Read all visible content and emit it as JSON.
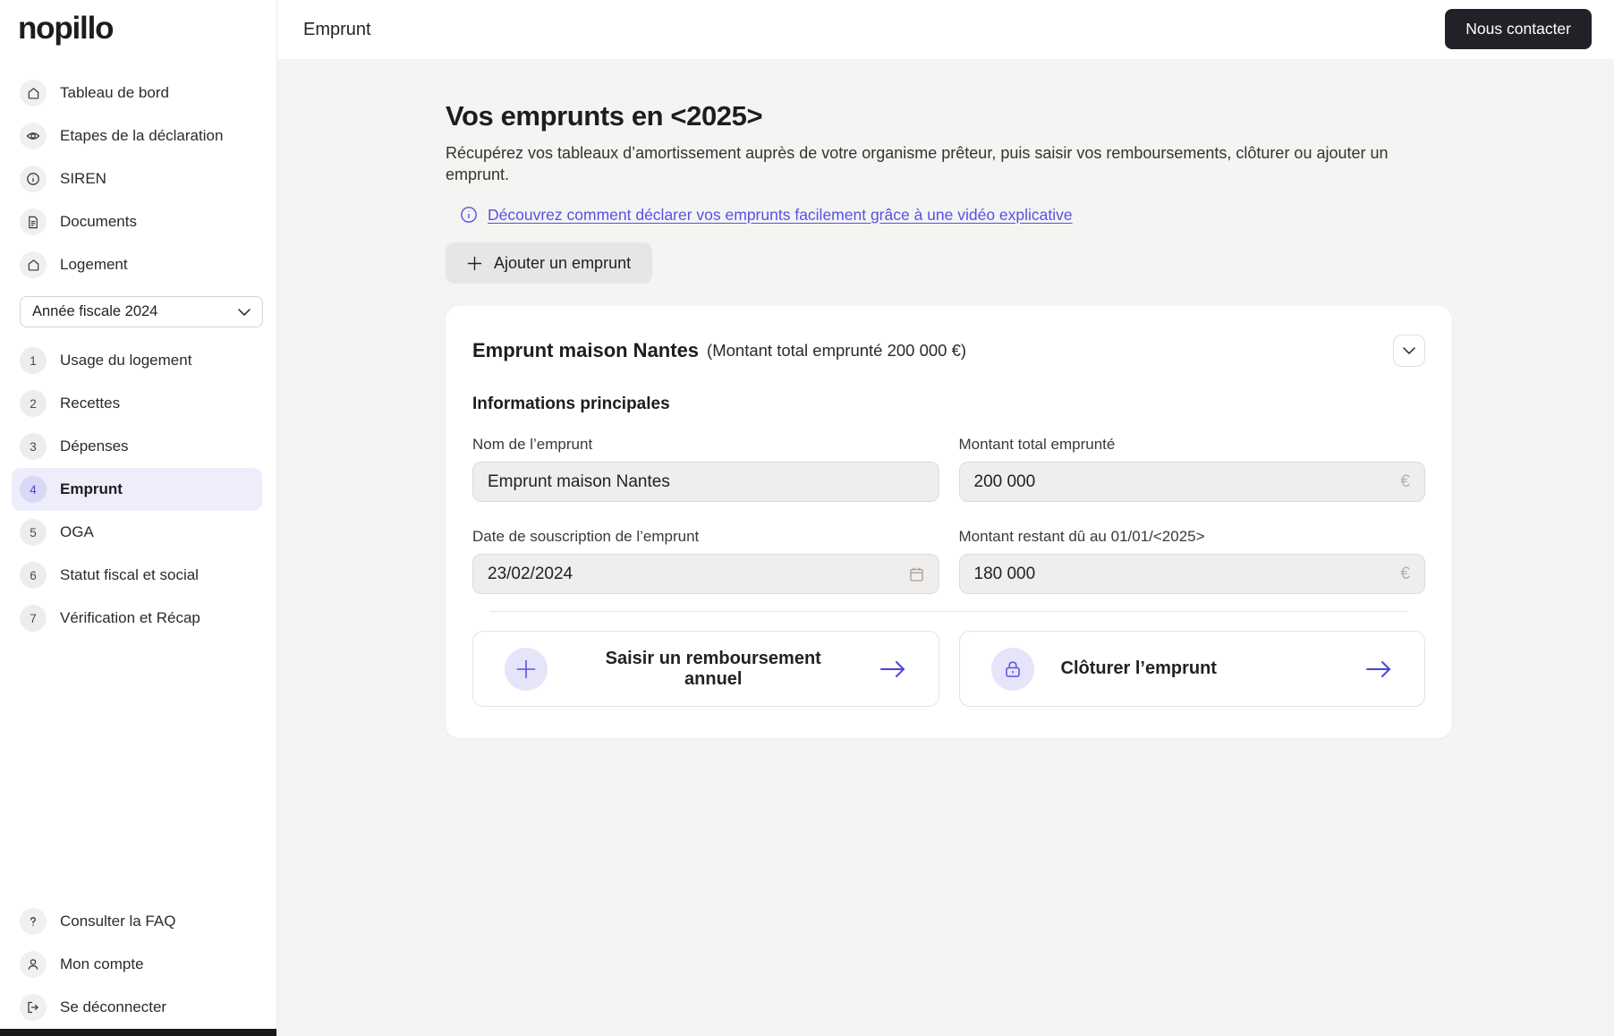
{
  "brand": "nopillo",
  "colors": {
    "accent_indigo": "#5652e2",
    "accent_lavender_bg": "#e6e4f9",
    "active_step_bg": "#eeedfb",
    "dark_button": "#232127",
    "page_bg": "#f4f4f3",
    "input_bg": "#efeeec"
  },
  "topbar": {
    "title": "Emprunt",
    "contact_button": "Nous contacter"
  },
  "sidebar": {
    "nav": [
      {
        "icon": "home-icon",
        "label": "Tableau de bord"
      },
      {
        "icon": "eye-icon",
        "label": "Etapes de la déclaration"
      },
      {
        "icon": "info-icon",
        "label": "SIREN"
      },
      {
        "icon": "document-icon",
        "label": "Documents"
      },
      {
        "icon": "home-icon",
        "label": "Logement"
      }
    ],
    "year_select": "Année fiscale 2024",
    "steps": [
      {
        "num": "1",
        "label": "Usage du logement",
        "active": false
      },
      {
        "num": "2",
        "label": "Recettes",
        "active": false
      },
      {
        "num": "3",
        "label": "Dépenses",
        "active": false
      },
      {
        "num": "4",
        "label": "Emprunt",
        "active": true
      },
      {
        "num": "5",
        "label": "OGA",
        "active": false
      },
      {
        "num": "6",
        "label": "Statut fiscal et social",
        "active": false
      },
      {
        "num": "7",
        "label": "Vérification et Récap",
        "active": false
      }
    ],
    "footer": [
      {
        "icon": "question-icon",
        "label": "Consulter la FAQ"
      },
      {
        "icon": "user-icon",
        "label": "Mon compte"
      },
      {
        "icon": "logout-icon",
        "label": "Se déconnecter"
      }
    ]
  },
  "main": {
    "heading": "Vos emprunts en <2025>",
    "subtitle": "Récupérez vos tableaux d’amortissement auprès de votre organisme prêteur, puis saisir vos remboursements, clôturer ou ajouter un emprunt.",
    "video_link": "Découvrez comment déclarer vos emprunts facilement grâce à une vidéo explicative",
    "add_button": "Ajouter un emprunt",
    "card": {
      "title": "Emprunt maison Nantes",
      "subtitle": "(Montant total emprunté 200 000 €)",
      "section_title": "Informations principales",
      "fields": [
        {
          "label": "Nom de l’emprunt",
          "value": "Emprunt maison Nantes",
          "suffix": ""
        },
        {
          "label": "Montant total emprunté",
          "value": "200 000",
          "suffix": "€"
        },
        {
          "label": "Date de souscription de l’emprunt",
          "value": "23/02/2024",
          "suffix": "calendar-icon"
        },
        {
          "label": "Montant restant dû au 01/01/<2025>",
          "value": "180 000",
          "suffix": "€"
        }
      ],
      "actions": [
        {
          "icon": "plus-icon",
          "label": "Saisir un remboursement annuel"
        },
        {
          "icon": "lock-icon",
          "label": "Clôturer l’emprunt"
        }
      ]
    }
  }
}
